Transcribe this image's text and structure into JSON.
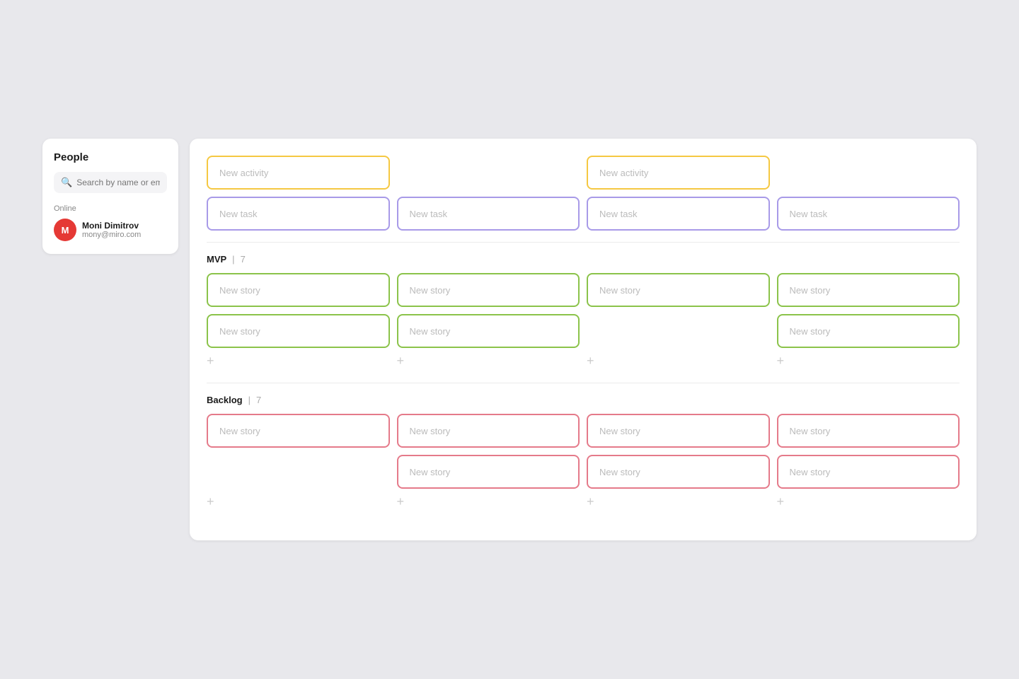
{
  "people_panel": {
    "title": "People",
    "search_placeholder": "Search by name or email",
    "online_label": "Online",
    "user": {
      "initial": "M",
      "name": "Moni Dimitrov",
      "email": "mony@miro.com"
    }
  },
  "board": {
    "activities_section": {
      "cards": [
        {
          "label": "New activity",
          "color": "yellow",
          "col": 0
        },
        {
          "label": "New activity",
          "color": "yellow",
          "col": 2
        }
      ],
      "task_cards": [
        {
          "label": "New task",
          "color": "purple"
        },
        {
          "label": "New task",
          "color": "purple"
        },
        {
          "label": "New task",
          "color": "purple"
        },
        {
          "label": "New task",
          "color": "purple"
        }
      ]
    },
    "mvp_section": {
      "name": "MVP",
      "count": "7",
      "rows": [
        [
          "New story",
          "New story",
          "New story",
          "New story"
        ],
        [
          "New story",
          "New story",
          "",
          "New story"
        ]
      ],
      "add_buttons": [
        true,
        true,
        true,
        true
      ]
    },
    "backlog_section": {
      "name": "Backlog",
      "count": "7",
      "rows": [
        [
          "New story",
          "New story",
          "New story",
          "New story"
        ],
        [
          "",
          "New story",
          "New story",
          "New story"
        ]
      ],
      "add_buttons": [
        true,
        true,
        true,
        true
      ]
    }
  }
}
